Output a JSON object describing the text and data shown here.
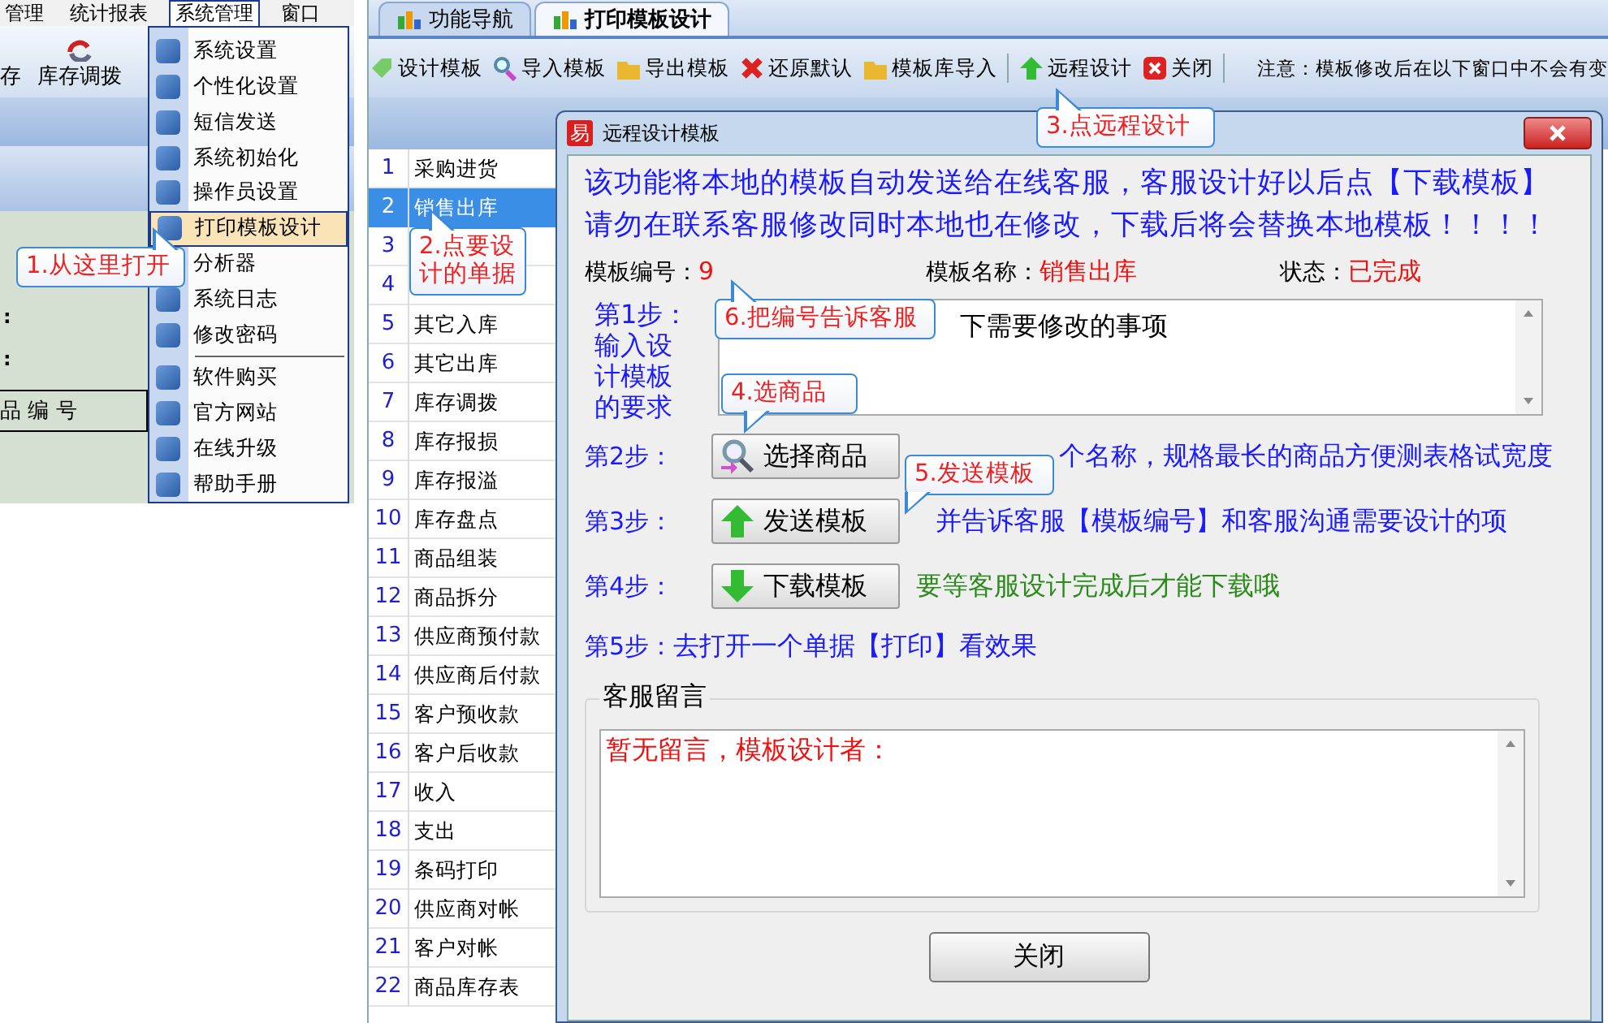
{
  "left_panel": {
    "menubar": [
      {
        "label": "管理",
        "selected": false
      },
      {
        "label": "统计报表",
        "selected": false
      },
      {
        "label": "系统管理",
        "selected": true
      },
      {
        "label": "窗口",
        "selected": false
      }
    ],
    "toolbar": [
      "存",
      "库存调拨"
    ],
    "form_labels": [
      ":",
      ":"
    ],
    "table_header": "品 编 号",
    "menu": [
      {
        "kind": "item",
        "label": "系统设置",
        "selected": false
      },
      {
        "kind": "item",
        "label": "个性化设置",
        "selected": false
      },
      {
        "kind": "item",
        "label": "短信发送",
        "selected": false
      },
      {
        "kind": "item",
        "label": "系统初始化",
        "selected": false
      },
      {
        "kind": "item",
        "label": "操作员设置",
        "selected": false
      },
      {
        "kind": "item",
        "label": "打印模板设计",
        "selected": true
      },
      {
        "kind": "item",
        "label": "分析器",
        "selected": false
      },
      {
        "kind": "item",
        "label": "系统日志",
        "selected": false
      },
      {
        "kind": "item",
        "label": "修改密码",
        "selected": false
      },
      {
        "kind": "separator"
      },
      {
        "kind": "item",
        "label": "软件购买",
        "selected": false
      },
      {
        "kind": "item",
        "label": "官方网站",
        "selected": false
      },
      {
        "kind": "item",
        "label": "在线升级",
        "selected": false
      },
      {
        "kind": "item",
        "label": "帮助手册",
        "selected": false
      }
    ]
  },
  "app": {
    "tabs": [
      {
        "label": "功能导航",
        "selected": false
      },
      {
        "label": "打印模板设计",
        "selected": true
      }
    ],
    "toolbar": [
      {
        "kind": "design",
        "label": "设计模板"
      },
      {
        "kind": "import",
        "label": "导入模板"
      },
      {
        "kind": "export",
        "label": "导出模板"
      },
      {
        "kind": "reset",
        "label": "还原默认"
      },
      {
        "kind": "library",
        "label": "模板库导入"
      },
      {
        "kind": "separator"
      },
      {
        "kind": "remote",
        "label": "远程设计"
      },
      {
        "kind": "close",
        "label": "关闭"
      },
      {
        "kind": "separator"
      }
    ],
    "notice": "注意：模板修改后在以下窗口中不会有变",
    "list": [
      {
        "number": "1",
        "name": "采购进货",
        "selected": false
      },
      {
        "number": "2",
        "name": "销售出库",
        "selected": true
      },
      {
        "number": "3",
        "selected": false
      },
      {
        "number": "4",
        "selected": false
      },
      {
        "number": "5",
        "name": "其它入库",
        "selected": false
      },
      {
        "number": "6",
        "name": "其它出库",
        "selected": false
      },
      {
        "number": "7",
        "name": "库存调拨",
        "selected": false
      },
      {
        "number": "8",
        "name": "库存报损",
        "selected": false
      },
      {
        "number": "9",
        "name": "库存报溢",
        "selected": false
      },
      {
        "number": "10",
        "name": "库存盘点",
        "selected": false
      },
      {
        "number": "11",
        "name": "商品组装",
        "selected": false
      },
      {
        "number": "12",
        "name": "商品拆分",
        "selected": false
      },
      {
        "number": "13",
        "name": "供应商预付款",
        "selected": false
      },
      {
        "number": "14",
        "name": "供应商后付款",
        "selected": false
      },
      {
        "number": "15",
        "name": "客户预收款",
        "selected": false
      },
      {
        "number": "16",
        "name": "客户后收款",
        "selected": false
      },
      {
        "number": "17",
        "name": "收入",
        "selected": false
      },
      {
        "number": "18",
        "name": "支出",
        "selected": false
      },
      {
        "number": "19",
        "name": "条码打印",
        "selected": false
      },
      {
        "number": "20",
        "name": "供应商对帐",
        "selected": false
      },
      {
        "number": "21",
        "name": "客户对帐",
        "selected": false
      },
      {
        "number": "22",
        "name": "商品库存表",
        "selected": false
      }
    ]
  },
  "dialog": {
    "icon_text": "易",
    "title": "远程设计模板",
    "intro": [
      "该功能将本地的模板自动发送给在线客服，客服设计好以后点【下载模板】",
      "请勿在联系客服修改同时本地也在修改，下载后将会替换本地模板！！！！"
    ],
    "info": [
      {
        "label": "模板编号：",
        "value": "9"
      },
      {
        "label": "模板名称：",
        "value": "销售出库"
      },
      {
        "label": "状态：",
        "value": "已完成"
      }
    ],
    "step1": {
      "label": "第1步：",
      "text": "输入设计模板的要求",
      "value": "下需要修改的事项"
    },
    "steps": [
      {
        "label": "第2步：",
        "kind": "select",
        "button": "选择商品",
        "note": "个名称，规格最长的商品方便测表格试宽度",
        "color": "#1a1aff"
      },
      {
        "label": "第3步：",
        "kind": "upload",
        "button": "发送模板",
        "note": "并告诉客服【模板编号】和客服沟通需要设计的项",
        "color": "#1a1aff"
      },
      {
        "label": "第4步：",
        "kind": "download",
        "button": "下载模板",
        "note": "要等客服设计完成后才能下载哦",
        "color": "#2a8a1a"
      }
    ],
    "step5": {
      "label": "第5步：",
      "text": "去打开一个单据【打印】看效果"
    },
    "message": {
      "legend": "客服留言",
      "value": "暂无留言，模板设计者："
    },
    "close_button": "关闭"
  },
  "callouts": [
    {
      "text": "1.从这里打开"
    },
    {
      "text": "2.点要设计的单据"
    },
    {
      "text": "3.点远程设计"
    },
    {
      "text": "4.选商品"
    },
    {
      "text": "5.发送模板"
    },
    {
      "text": "6.把编号告诉客服"
    }
  ]
}
